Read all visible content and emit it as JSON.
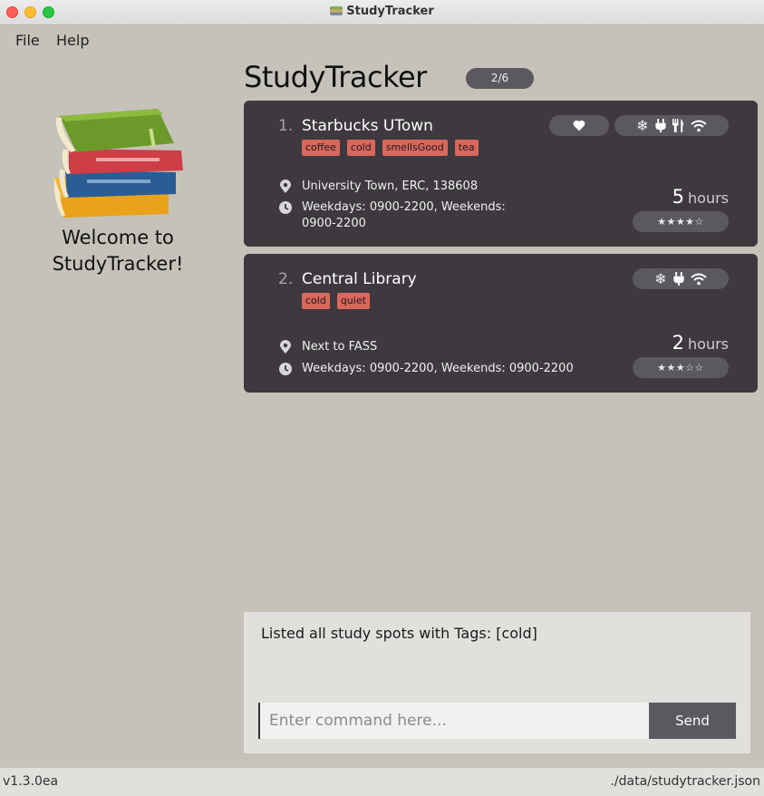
{
  "window": {
    "title": "StudyTracker"
  },
  "menu": {
    "file": "File",
    "help": "Help"
  },
  "sidebar": {
    "welcome_line1": "Welcome to",
    "welcome_line2": "StudyTracker!"
  },
  "header": {
    "title": "StudyTracker",
    "count": "2/6"
  },
  "spots": [
    {
      "index": "1.",
      "name": "Starbucks UTown",
      "tags": [
        "coffee",
        "cold",
        "smellsGood",
        "tea"
      ],
      "favourite": true,
      "amenities": [
        "snowflake-icon",
        "plug-icon",
        "utensils-icon",
        "wifi-icon"
      ],
      "address": "University Town, ERC, 138608",
      "hours_line1": "Weekdays: 0900-2200, Weekends:",
      "hours_line2": "0900-2200",
      "duration": "5",
      "duration_unit": "hours",
      "rating_stars": "★★★★☆",
      "rating": 4
    },
    {
      "index": "2.",
      "name": "Central Library",
      "tags": [
        "cold",
        "quiet"
      ],
      "favourite": false,
      "amenities": [
        "snowflake-icon",
        "plug-icon",
        "wifi-icon"
      ],
      "address": "Next to FASS",
      "hours_line1": "Weekdays: 0900-2200, Weekends: 0900-2200",
      "duration": "2",
      "duration_unit": "hours",
      "rating_stars": "★★★☆☆",
      "rating": 3
    }
  ],
  "result": {
    "text": "Listed all study spots with Tags: [cold]"
  },
  "command": {
    "placeholder": "Enter command here...",
    "value": "",
    "send_label": "Send"
  },
  "status": {
    "version": "v1.3.0ea",
    "file_path": "./data/studytracker.json"
  }
}
